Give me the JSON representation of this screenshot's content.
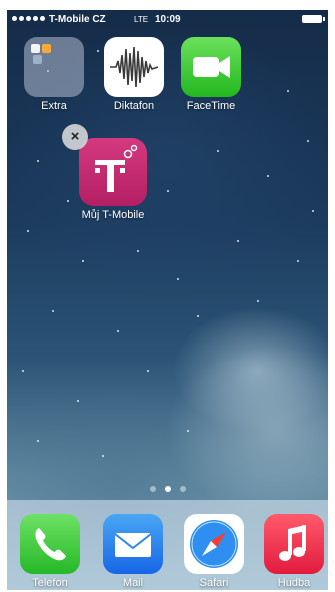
{
  "status_bar": {
    "carrier": "T-Mobile CZ",
    "network": "LTE",
    "time": "10:09",
    "battery_level": 1.0
  },
  "home_screen": {
    "apps": [
      {
        "label": "Extra",
        "icon": "folder-icon"
      },
      {
        "label": "Diktafon",
        "icon": "voice-memos-icon"
      },
      {
        "label": "FaceTime",
        "icon": "facetime-icon"
      },
      {
        "label": "Můj T-Mobile",
        "icon": "t-mobile-icon",
        "delete_badge": "×"
      }
    ],
    "page_count": 3,
    "current_page": 2
  },
  "dock": {
    "apps": [
      {
        "label": "Telefon",
        "icon": "phone-icon"
      },
      {
        "label": "Mail",
        "icon": "mail-icon"
      },
      {
        "label": "Safari",
        "icon": "safari-icon"
      },
      {
        "label": "Hudba",
        "icon": "music-icon"
      }
    ]
  },
  "colors": {
    "tmobile_magenta": "#c42a72",
    "facetime_green": "#3fcf38",
    "mail_blue": "#2f86f0",
    "music_red": "#f2334f"
  }
}
